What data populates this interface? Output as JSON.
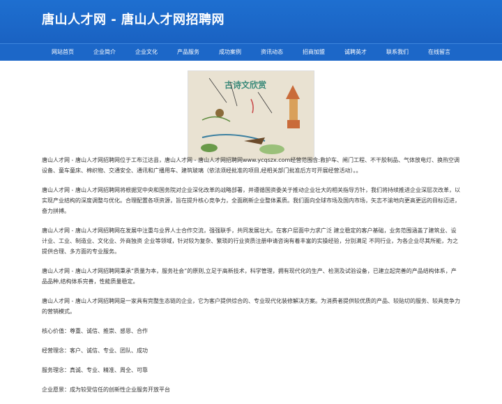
{
  "header": {
    "title": "唐山人才网 - 唐山人才网招聘网"
  },
  "nav": [
    "网站首页",
    "企业简介",
    "企业文化",
    "产品服务",
    "成功案例",
    "资讯动态",
    "招商加盟",
    "诚聘英才",
    "联系我们",
    "在线留言"
  ],
  "hero": {
    "image_text": "古诗文欣赏",
    "brand_color": "#1e6fd0"
  },
  "content": {
    "paragraphs": [
      "唐山人才网 - 唐山人才网招聘网位于工布江达县，唐山人才网 - 唐山人才网招聘网www.ycqszx.com经营范围含:救护车、闸门工程、不干胶制品、气体放电灯、换热空调设备、童车童床、棉织物、交通安全、通讯和广播用车、建筑玻璃（依法须经批准的项目,经相关部门批准后方可开展经营活动）。。",
      "唐山人才网 - 唐山人才网招聘网将根据党中央和国务院对企业深化改革的战略部署，并遵循国资委关于推动企业壮大的相关指导方针，我们将持续推进企业深层次改革，以实现产业结构的深度调整与优化。合理配置各项资源，旨在提升核心竞争力，全面刷新企业整体素质。我们面向全球市场及国内市场，矢志不渝地向更高更远的目标迈进，奋力拼搏。",
      "唐山人才网 - 唐山人才网招聘网在发展中注重与业界人士合作交流，强强联手，共同发展壮大。在客户层面中力求广泛 建立稳定的客户基础，业务范围涵盖了建筑业、设计业、工业、制造业、文化业、外商独资 企业等领域，针对较为复杂、繁琐的行业资质注册申请咨询有着丰富的实操经验，分别满足 不同行业，为各企业尽其所能，为之提供合理、多方面的专业服务。",
      "唐山人才网 - 唐山人才网招聘网秉承“质量为本，服务社会”的原则,立足于高新技术，科学管理，拥有现代化的生产、检测及试验设备，已建立起完善的产品结构体系，产品品种,结构体系完善，性能质量稳定。",
      "唐山人才网 - 唐山人才网招聘网是一家具有完整生态链的企业，它为客户提供综合的、专业现代化装修解决方案。为消费者提供较优质的产品、较贴切的服务、较具竞争力的营销模式。",
      "核心价值：尊重、诚信、推崇、感恩、合作",
      "经营理念：客户、诚信、专业、团队、成功",
      "服务理念：真诚、专业、精准、周全、可靠",
      "企业愿景：成为较受信任的创新性企业服务开放平台"
    ]
  }
}
